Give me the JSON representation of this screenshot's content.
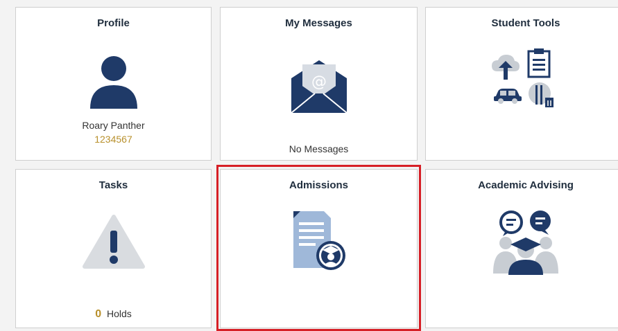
{
  "tiles": {
    "profile": {
      "title": "Profile",
      "name": "Roary Panther",
      "id": "1234567"
    },
    "messages": {
      "title": "My Messages",
      "status": "No Messages"
    },
    "student_tools": {
      "title": "Student Tools"
    },
    "tasks": {
      "title": "Tasks",
      "holds_count": "0",
      "holds_label": "Holds"
    },
    "admissions": {
      "title": "Admissions"
    },
    "advising": {
      "title": "Academic Advising"
    }
  },
  "colors": {
    "icon_navy": "#1f3a68",
    "icon_light_blue": "#9fb8d9",
    "icon_gray": "#c8cdd3",
    "id_gold": "#b8902c",
    "highlight_red": "#d61f26"
  }
}
